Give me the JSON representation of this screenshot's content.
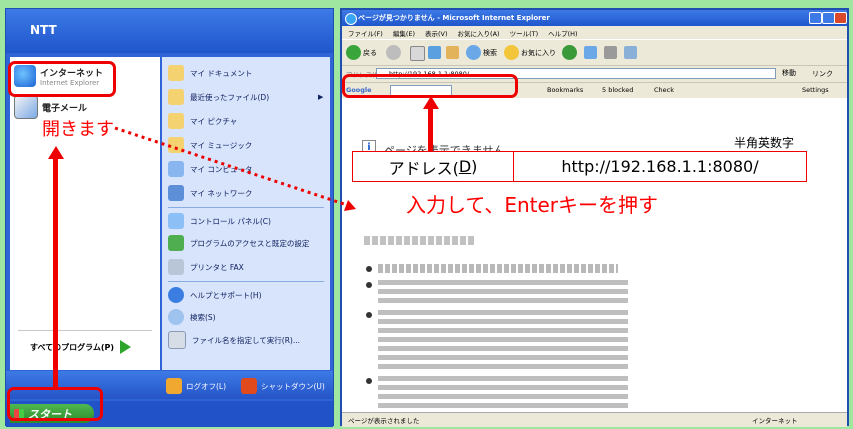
{
  "start_menu": {
    "user_name": "NTT",
    "pinned": [
      {
        "title": "インターネット",
        "subtitle": "Internet Explorer"
      },
      {
        "title": "電子メール",
        "subtitle": ""
      }
    ],
    "all_programs": "すべてのプログラム(P)",
    "right_items": [
      "マイ ドキュメント",
      "最近使ったファイル(D)",
      "マイ ピクチャ",
      "マイ ミュージック",
      "マイ コンピュータ",
      "マイ ネットワーク",
      "コントロール パネル(C)",
      "プログラムのアクセスと既定の設定",
      "プリンタと FAX",
      "ヘルプとサポート(H)",
      "検索(S)",
      "ファイル名を指定して実行(R)..."
    ],
    "logoff": "ログオフ(L)",
    "shutdown": "シャットダウン(U)",
    "start_button": "スタート"
  },
  "ie": {
    "title": "ページが見つかりません - Microsoft Internet Explorer",
    "menu": [
      "ファイル(F)",
      "編集(E)",
      "表示(V)",
      "お気に入り(A)",
      "ツール(T)",
      "ヘルプ(H)"
    ],
    "back_label": "戻る",
    "search_label": "検索",
    "favorites_label": "お気に入り",
    "address_label": "アドレス(D)",
    "address_value": "http://192.168.1.1:8080/",
    "go_label": "移動",
    "links_label": "リンク",
    "google_label": "Google",
    "bookmarks_label": "Bookmarks",
    "blocked_label": "5 blocked",
    "check_label": "Check",
    "settings_label": "Settings",
    "page_error": "ページを表示できません。",
    "status_left": "ページが表示されました",
    "status_right": "インターネット"
  },
  "annotations": {
    "open_label": "開きます",
    "hankaku": "半角英数字",
    "address_cell_label_prefix": "アドレス(",
    "address_cell_label_key": "D",
    "address_cell_label_suffix": ")",
    "address_cell_value": "http://192.168.1.1:8080/",
    "instruction": "入力して、Enterキーを押す"
  },
  "colors": {
    "background": "#9fe6a0",
    "highlight": "#ff0000",
    "xp_blue": "#2e64d6"
  }
}
